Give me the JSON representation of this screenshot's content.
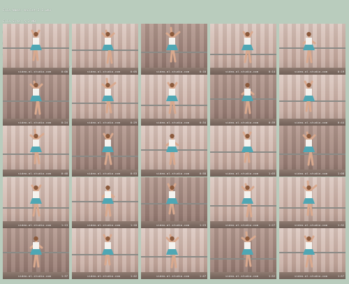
{
  "header": {
    "lines": [
      "File Name: ballet-2-1.wmv",
      "File Size: 5,2 MB",
      "Resolution: 320x240",
      "Duration: 00:02:01",
      "Video: WMV3, 491 Kbps, 15.000 fps",
      "Audio: WMA, 32 Kbps, 44.1 KHz, 1 channels"
    ]
  },
  "watermark": "video-al-studio.com",
  "thumbnails": [
    {
      "time": "0:00"
    },
    {
      "time": "0:05"
    },
    {
      "time": "0:10"
    },
    {
      "time": "0:14"
    },
    {
      "time": "0:19"
    },
    {
      "time": "0:24"
    },
    {
      "time": "0:29"
    },
    {
      "time": "0:34"
    },
    {
      "time": "0:39"
    },
    {
      "time": "0:44"
    },
    {
      "time": "0:48"
    },
    {
      "time": "0:53"
    },
    {
      "time": "0:58"
    },
    {
      "time": "1:03"
    },
    {
      "time": "1:08"
    },
    {
      "time": "1:13"
    },
    {
      "time": "1:18"
    },
    {
      "time": "1:23"
    },
    {
      "time": "1:27"
    },
    {
      "time": "1:32"
    },
    {
      "time": "1:37"
    },
    {
      "time": "1:42"
    },
    {
      "time": "1:47"
    },
    {
      "time": "1:52"
    },
    {
      "time": "1:57"
    }
  ]
}
